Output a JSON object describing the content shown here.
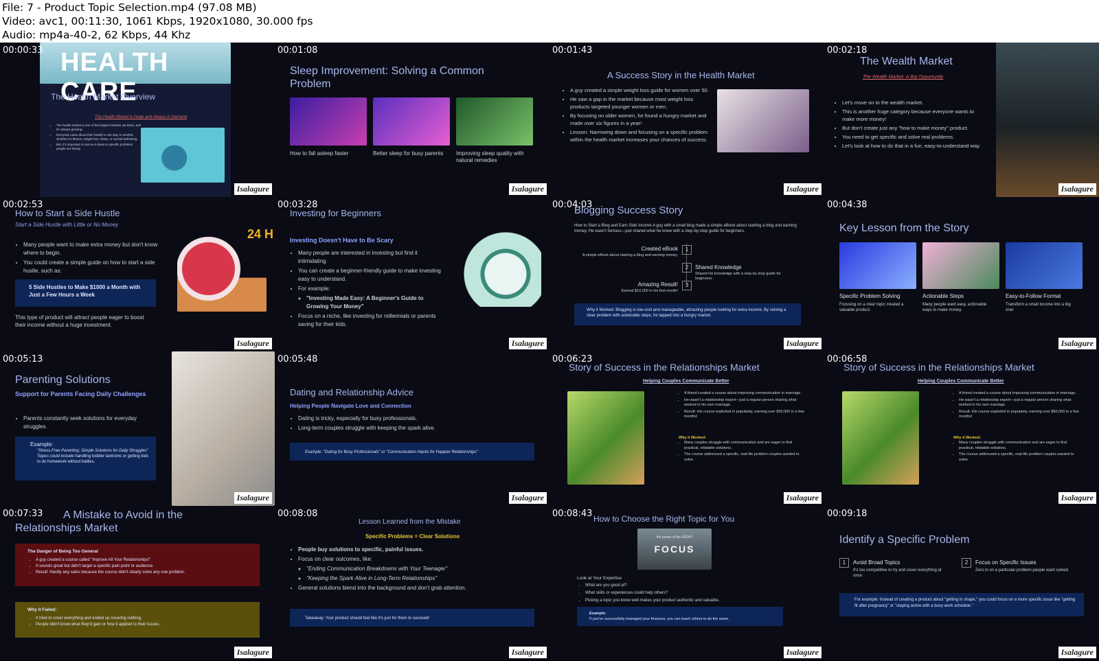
{
  "header": {
    "file_line": "File: 7 - Product Topic Selection.mp4 (97.08 MB)",
    "video_line": "Video: avc1, 00:11:30, 1061 Kbps, 1920x1080, 30.000 fps",
    "audio_line": "Audio: mp4a-40-2, 62 Kbps, 44 Khz"
  },
  "watermark": "Isalagure",
  "colors": {
    "accent": "#a9b8ee",
    "panel": "#0e2557",
    "background": "#0a0b14"
  },
  "frames": [
    {
      "time": "00:00:33",
      "title": "The Health Market Overview",
      "subtitle": "The Health Market is Huge and Always in Demand",
      "banner": "HEALTH CARE",
      "bullets": [
        "The health market is one of the largest markets out there, and it's always growing.",
        "Everyone cares about their health in one way or another, whether it's fitness, weight loss, sleep, or overall well-being.",
        "But, it's important to narrow it down to specific problems people are facing."
      ]
    },
    {
      "time": "00:01:08",
      "title": "Sleep Improvement: Solving a Common Problem",
      "captions": [
        "How to fall asleep faster",
        "Better sleep for busy parents",
        "Improving sleep quality with natural remedies"
      ]
    },
    {
      "time": "00:01:43",
      "title": "A Success Story in the Health Market",
      "bullets": [
        "A guy created a simple weight loss guide for women over 50.",
        "He saw a gap in the market because most weight loss products targeted younger women or men.",
        "By focusing on older women, he found a hungry market and made over six figures in a year!",
        "Lesson: Narrowing down and focusing on a specific problem within the health market increases your chances of success."
      ]
    },
    {
      "time": "00:02:18",
      "title": "The Wealth Market",
      "subtitle": "The Wealth Market: A Big Opportunity",
      "bullets": [
        "Let's move on to the wealth market.",
        "This is another huge category because everyone wants to make more money!",
        "But don't create just any \"how to make money\" product.",
        "You need to get specific and solve real problems.",
        "Let's look at how to do that in a fun, easy-to-understand way."
      ]
    },
    {
      "time": "00:02:53",
      "title": "How to Start a Side Hustle",
      "subtitle": "Start a Side Hustle with Little or No Money",
      "bullets": [
        "Many people want to make extra money but don't know where to begin.",
        "You could create a simple guide on how to start a side hustle, such as:"
      ],
      "box": "5 Side Hustles to Make $1000 a Month with Just a Few Hours a Week",
      "footer": "This type of product will attract people eager to boost their income without a huge investment.",
      "badge": "24 H"
    },
    {
      "time": "00:03:28",
      "title": "Investing for Beginners",
      "heading": "Investing Doesn't Have to Be Scary",
      "bullets": [
        "Many people are interested in investing but find it intimidating.",
        "You can create a beginner-friendly guide to make investing easy to understand.",
        "For example:",
        "\"Investing Made Easy: A Beginner's Guide to Growing Your Money\"",
        "Focus on a niche, like investing for millennials or parents saving for their kids."
      ]
    },
    {
      "time": "00:04:03",
      "title": "Blogging Success Story",
      "intro": "How to Start a Blog and Earn Side Income A guy with a small blog made a simple eBook about starting a blog and earning money. He wasn't famous—just shared what he knew with a step-by-step guide for beginners.",
      "steps": [
        {
          "n": "1",
          "label": "Created eBook",
          "desc": "A simple eBook about starting a blog and earning money."
        },
        {
          "n": "2",
          "label": "Shared Knowledge",
          "desc": "Shared his knowledge with a step-by-step guide for beginners."
        },
        {
          "n": "3",
          "label": "Amazing Result!",
          "desc": "Earned $10,000 in his first month!"
        }
      ],
      "box": "Why it Worked: Blogging is low-cost and manageable, attracting people looking for extra income. By solving a clear problem with actionable steps, he tapped into a hungry market."
    },
    {
      "time": "00:04:38",
      "title": "Key Lesson from the Story",
      "cards": [
        {
          "label": "Specific Problem Solving",
          "desc": "Focusing on a clear topic created a valuable product."
        },
        {
          "label": "Actionable Steps",
          "desc": "Many people want easy, actionable ways to make money."
        },
        {
          "label": "Easy-to-Follow Format",
          "desc": "Transform a small income into a big one!"
        }
      ]
    },
    {
      "time": "00:05:13",
      "title": "Parenting Solutions",
      "heading": "Support for Parents Facing Daily Challenges",
      "bullets": [
        "Parents constantly seek solutions for everyday struggles."
      ],
      "box_title": "Example:",
      "box_items": [
        "\"Stress-Free Parenting: Simple Solutions for Daily Struggles\"",
        "Topics could include handling toddler tantrums or getting kids to do homework without battles."
      ]
    },
    {
      "time": "00:05:48",
      "title": "Dating and Relationship Advice",
      "heading": "Helping People Navigate Love and Connection",
      "bullets": [
        "Dating is tricky, especially for busy professionals.",
        "Long-term couples struggle with keeping the spark alive."
      ],
      "box": "Example: \"Dating for Busy Professionals\" or \"Communication Hacks for Happier Relationships\""
    },
    {
      "time": "00:06:23",
      "title": "Story of Success in the Relationships Market",
      "subtitle": "Helping Couples Communicate Better",
      "bullets": [
        "A friend created a course about improving communication in marriage.",
        "He wasn't a relationship expert—just a regular person sharing what worked in his own marriage.",
        "Result: His course exploded in popularity, earning over $50,000 in a few months!"
      ],
      "why": "Why it Worked:",
      "why_bullets": [
        "Many couples struggle with communication and are eager to find practical, relatable solutions.",
        "The course addressed a specific, real-life problem couples wanted to solve."
      ]
    },
    {
      "time": "00:06:58",
      "title": "Story of Success in the Relationships Market",
      "subtitle": "Helping Couples Communicate Better",
      "bullets": [
        "A friend created a course about improving communication in marriage.",
        "He wasn't a relationship expert—just a regular person sharing what worked in his own marriage.",
        "Result: His course exploded in popularity, earning over $50,000 in a few months!"
      ],
      "why": "Why it Worked:",
      "why_bullets": [
        "Many couples struggle with communication and are eager to find practical, relatable solutions.",
        "The course addressed a specific, real-life problem couples wanted to solve."
      ]
    },
    {
      "time": "00:07:33",
      "title": "A Mistake to Avoid in the Relationships Market",
      "box1_title": "The Danger of Being Too General",
      "box1_items": [
        "A guy created a course called \"Improve All Your Relationships!\"",
        "It sounds great but didn't target a specific pain point or audience.",
        "Result: Hardly any sales because the course didn't clearly solve any one problem."
      ],
      "box2_title": "Why it Failed:",
      "box2_items": [
        "It tried to cover everything and ended up covering nothing.",
        "People didn't know what they'd gain or how it applied to their issues."
      ]
    },
    {
      "time": "00:08:08",
      "title": "Lesson Learned from the Mistake",
      "heading": "Specific Problems = Clear Solutions",
      "bullets": [
        "People buy solutions to specific, painful issues.",
        "Focus on clear outcomes, like:",
        "\"Ending Communication Breakdowns with Your Teenager\"",
        "\"Keeping the Spark Alive in Long-Term Relationships\"",
        "General solutions blend into the background and don't grab attention."
      ],
      "box": "Takeaway: Your product should feel like it's just for them to succeed!"
    },
    {
      "time": "00:08:43",
      "title": "How to Choose the Right Topic for You",
      "image_text": "FOCUS",
      "image_small": "the power of the RIGHT",
      "lead": "Look at Your Expertise",
      "bullets": [
        "What are you good at?",
        "What skills or experiences could help others?",
        "Picking a topic you know well makes your product authentic and valuable."
      ],
      "box_title": "Example:",
      "box": "If you've successfully managed your finances, you can teach others to do the same."
    },
    {
      "time": "00:09:18",
      "title": "Identify a Specific Problem",
      "items": [
        {
          "n": "1",
          "label": "Avoid Broad Topics",
          "desc": "It's too competitive to try and cover everything at once."
        },
        {
          "n": "2",
          "label": "Focus on Specific Issues",
          "desc": "Zero in on a particular problem people want solved."
        }
      ],
      "box": "For example: Instead of creating a product about \"getting in shape,\" you could focus on a more specific issue like \"getting fit after pregnancy\" or \"staying active with a busy work schedule.\""
    }
  ]
}
